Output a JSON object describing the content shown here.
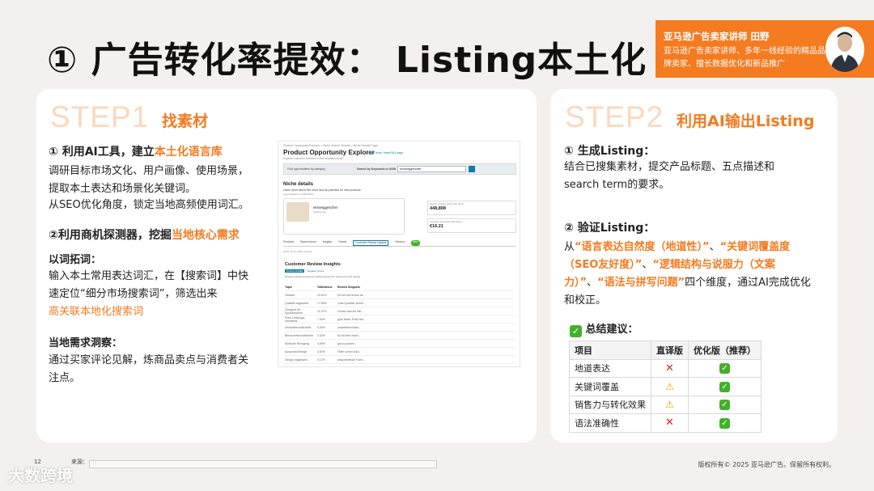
{
  "slide": {
    "title": "① 广告转化率提效： Listing本土化",
    "page_number": "12",
    "source_label": "来源：",
    "copyright": "版权所有© 2025 亚马逊广告。保留所有权利。",
    "watermark": "大数跨境"
  },
  "speaker": {
    "name": "亚马逊广告卖家讲师 田野",
    "desc": "亚马逊广告卖家讲师、多年一线经验的精品品牌卖家、擅长数据优化和新品推广"
  },
  "step1": {
    "label": "STEP1",
    "sub": "找素材",
    "h1_prefix": "① 利用AI工具，建立",
    "h1_hl": "本土化语言库",
    "p1": "调研目标市场文化、用户画像、使用场景，提取本土表达和场景化关键词。",
    "p2": "从SEO优化角度，锁定当地高频使用词汇。",
    "h2_prefix": "②利用商机探测器，挖掘",
    "h2_hl": "当地核心需求",
    "sub1": "以词拓词：",
    "p3": "输入本土常用表达词汇，在【搜索词】中快速定位“细分市场搜索词”，筛选出来",
    "p3_hl": "高关联本地化搜索词",
    "sub2": "当地需求洞察：",
    "p4": "通过买家评论见解，炼商品卖点与消费者关注点。"
  },
  "screenshot": {
    "breadcrumb": "Product Opportunity Explorer > Niche Search Results > Niche Details Page",
    "title": "Product Opportunity Explorer",
    "learn": "Learn more",
    "help": "Help/FAQ page",
    "subtitle": "Explore customer demand in the selected niche",
    "find_label": "Find opportunities by category",
    "search_label": "Search by Keywords or ASIN",
    "search_value": "ekurweggeschier",
    "niche_title": "Niche details",
    "niche_desc": "Learn more about this niche and its potential for new products",
    "last_updated": "Last updated on 2025-06-07",
    "product_name": "ekrweggeschirr",
    "product_sub": "Kinderkonig",
    "metric1_label": "Search Volume (Past 360 days)",
    "metric1_value": "448,808",
    "metric2_label": "Average price(Past 360 days)",
    "metric2_value": "€16.21",
    "tabs": [
      "Products",
      "Search terms",
      "Insights",
      "Trends",
      "Customer Review Insights",
      "Returns"
    ],
    "new_badge": "New",
    "crumbs": "Niche Tools: Niche Tutorial",
    "section_title": "Customer Review Insights",
    "insight_btn": "Product Details",
    "insight_btn2": "Negative Topics",
    "insight_desc": "Review insights provide key selling points from review text and ratings.",
    "col_topic": "Topic",
    "col_pct": "%Mentions",
    "col_snip": "Review Snippets",
    "rows": [
      [
        "Gesamt",
        "19.61%",
        "So toll und schön ist..."
      ],
      [
        "Qualität insgesamt",
        "17.89%",
        "Gute Qualität, schön..."
      ],
      [
        "Geeignet für Spülmaschine",
        "11.07%",
        "Genau was ich will..."
      ],
      [
        "Preis-Leistungs-Verhältnis",
        "7.69%",
        "gute Ware, Preis fair..."
      ],
      [
        "Umweltfreundlichkeit",
        "5.30%",
        "umweltfreundlich..."
      ],
      [
        "Benutzerfreundlichkeit",
        "4.32%",
        "Es ist sehr leicht..."
      ],
      [
        "Einfache Reinigung",
        "3.69%",
        "gut zu putzen..."
      ],
      [
        "Aussehen/Design",
        "3.81%",
        "Teller schön bunt..."
      ],
      [
        "Design insgesamt",
        "3.17%",
        "ansprechende Form..."
      ]
    ]
  },
  "step2": {
    "label": "STEP2",
    "sub": "利用AI输出Listing",
    "h1": "① 生成Listing：",
    "p1": "结合已搜集素材，提交产品标题、五点描述和search term的要求。",
    "h2": "② 验证Listing：",
    "p2_a": "从",
    "p2_q1": "“语言表达自然度（地道性）”",
    "p2_b": "、",
    "p2_q2": "“关键词覆盖度（SEO友好度）”",
    "p2_c": "、",
    "p2_q3": "“逻辑结构与说服力（文案力）”",
    "p2_d": "、",
    "p2_q4": "“语法与拼写问题”",
    "p2_e": "四个维度，通过AI完成优化和校正。",
    "summary_icon": "check-box-icon",
    "summary": "总结建议：",
    "table": {
      "headers": [
        "项目",
        "直译版",
        "优化版（推荐）"
      ],
      "rows": [
        {
          "item": "地道表达",
          "direct": "cross",
          "opt": "check"
        },
        {
          "item": "关键词覆盖",
          "direct": "warning",
          "opt": "check"
        },
        {
          "item": "销售力与转化效果",
          "direct": "warning",
          "opt": "check"
        },
        {
          "item": "语法准确性",
          "direct": "cross",
          "opt": "check"
        }
      ]
    }
  }
}
